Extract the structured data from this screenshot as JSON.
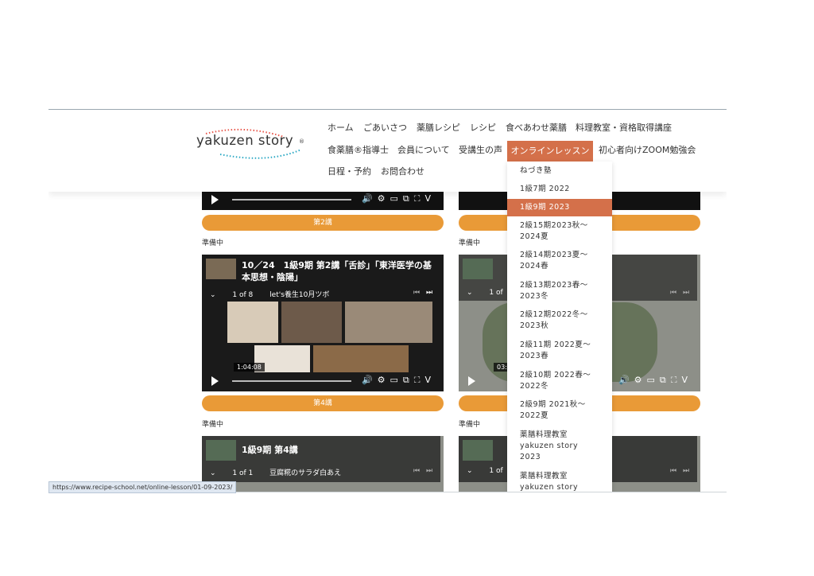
{
  "logo": {
    "text": "yakuzen story",
    "reg": "®"
  },
  "nav": {
    "row1": [
      "ホーム",
      "ごあいさつ",
      "薬膳レシピ",
      "レシピ",
      "食べあわせ薬膳",
      "料理教室・資格取得講座"
    ],
    "row2": [
      "食薬膳®指導士",
      "会員について",
      "受講生の声",
      "オンラインレッスン",
      "初心者向けZOOM勉強会"
    ],
    "row3": [
      "日程・予約",
      "お問合わせ"
    ]
  },
  "dropdown": {
    "items": [
      "ねづき塾",
      "1級7期 2022",
      "1級9期 2023",
      "2級15期2023秋～\n2024夏",
      "2級14期2023夏～\n2024春",
      "2級13期2023春～\n2023冬",
      "2級12期2022冬～\n2023秋",
      "2級11期 2022夏～\n2023春",
      "2級10期 2022春～\n2022冬",
      "2級9期 2021秋～\n2022夏",
      "薬膳料理教室\nyakuzen story\n2023",
      "薬膳料理教室\nyakuzen story"
    ],
    "active_index": 2
  },
  "content": {
    "lecture2": "第2講",
    "lecture4": "第4講",
    "preparing": "準備中",
    "video1": {
      "title": "10／24　1級9期 第2講「舌診」「東洋医学の基本思想・陰陽」",
      "counter": "1 of 8",
      "subtitle": "let's養生10月ツボ",
      "time": "1:04:08"
    },
    "video2": {
      "counter": "1 of",
      "time": "03:2"
    },
    "video3": {
      "title": "1級9期 第4講",
      "counter": "1 of 1",
      "subtitle": "豆腐糀のサラダ白あえ"
    },
    "video4": {
      "counter": "1 of"
    }
  },
  "status_url": "https://www.recipe-school.net/online-lesson/01-09-2023/",
  "colors": {
    "accent": "#d4704a",
    "button": "#e99a37"
  }
}
